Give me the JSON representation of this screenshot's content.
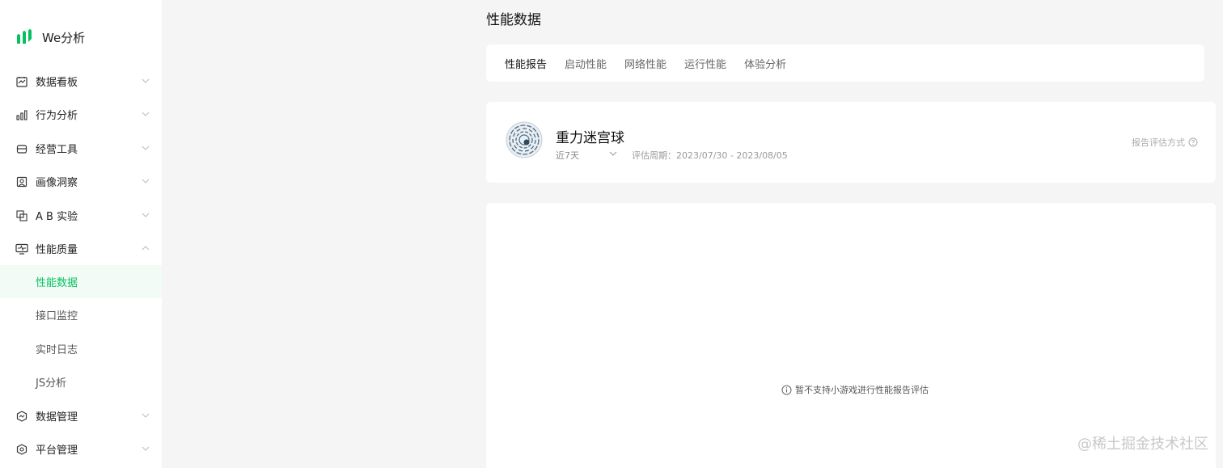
{
  "app": {
    "name": "We分析"
  },
  "sidebar": {
    "items": [
      {
        "label": "数据看板",
        "icon": "dashboard-icon"
      },
      {
        "label": "行为分析",
        "icon": "bar-chart-icon"
      },
      {
        "label": "经营工具",
        "icon": "shop-icon"
      },
      {
        "label": "画像洞察",
        "icon": "portrait-icon"
      },
      {
        "label": "A B 实验",
        "icon": "ab-test-icon"
      },
      {
        "label": "性能质量",
        "icon": "monitor-icon"
      },
      {
        "label": "数据管理",
        "icon": "data-manage-icon"
      },
      {
        "label": "平台管理",
        "icon": "settings-icon"
      }
    ],
    "subitems": [
      {
        "label": "性能数据",
        "active": true
      },
      {
        "label": "接口监控"
      },
      {
        "label": "实时日志"
      },
      {
        "label": "JS分析"
      }
    ]
  },
  "page": {
    "title": "性能数据"
  },
  "tabs": [
    {
      "label": "性能报告",
      "active": true
    },
    {
      "label": "启动性能"
    },
    {
      "label": "网络性能"
    },
    {
      "label": "运行性能"
    },
    {
      "label": "体验分析"
    }
  ],
  "game": {
    "name": "重力迷宫球",
    "range": "近7天",
    "period": "评估周期：2023/07/30 - 2023/08/05",
    "eval_method": "报告评估方式"
  },
  "empty_message": "暂不支持小游戏进行性能报告评估",
  "watermark": "@稀土掘金技术社区",
  "colors": {
    "accent": "#07c160",
    "active_bg": "#f3fbf6"
  }
}
